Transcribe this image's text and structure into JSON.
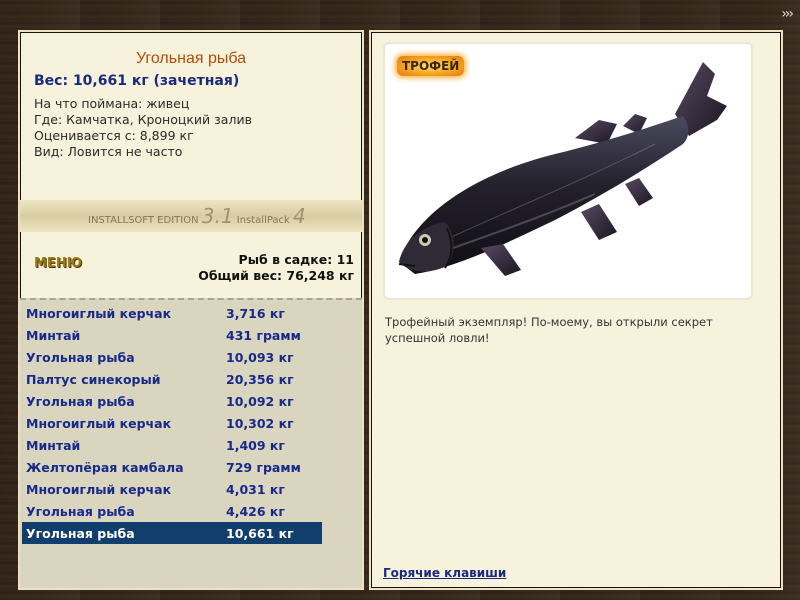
{
  "nav": {
    "next_icon": "triple-chevron-right-icon",
    "next_label": "›››"
  },
  "fish": {
    "title": "Угольная рыба",
    "weight": "Вес: 10,661 кг (зачетная)",
    "bait": "На что поймана: живец",
    "location": "Где: Камчатка, Кроноцкий залив",
    "valued_from": "Оценивается с: 8,899 кг",
    "rarity": "Вид: Ловится не часто"
  },
  "watermark": {
    "line1": "INSTALLSOFT EDITION",
    "version": "3.1",
    "pack": "InstallPack",
    "pack_version": "4"
  },
  "menu": {
    "label": "МЕНЮ"
  },
  "keepnet": {
    "count": "Рыб в садке: 11",
    "total_weight": "Общий вес: 76,248 кг"
  },
  "catches": [
    {
      "name": "Многоиглый керчак",
      "weight": "3,716 кг"
    },
    {
      "name": "Минтай",
      "weight": "431 грамм"
    },
    {
      "name": "Угольная рыба",
      "weight": "10,093 кг"
    },
    {
      "name": "Палтус синекорый",
      "weight": "20,356 кг"
    },
    {
      "name": "Угольная рыба",
      "weight": "10,092 кг"
    },
    {
      "name": "Многоиглый керчак",
      "weight": "10,302 кг"
    },
    {
      "name": "Минтай",
      "weight": "1,409 кг"
    },
    {
      "name": "Желтопёрая камбала",
      "weight": "729 грамм"
    },
    {
      "name": "Многоиглый керчак",
      "weight": "4,031 кг"
    },
    {
      "name": "Угольная рыба",
      "weight": "4,426 кг"
    },
    {
      "name": "Угольная рыба",
      "weight": "10,661 кг"
    }
  ],
  "selected_index": 10,
  "photo": {
    "badge": "ТРОФЕЙ",
    "image": "sablefish-photo"
  },
  "trophy_text": "Трофейный экземпляр! По-моему, вы открыли секрет успешной ловли!",
  "hotkeys": "Горячие клавиши",
  "colors": {
    "accent_title": "#b04e0a",
    "list_text": "#172a8a",
    "selection": "#123e6e",
    "panel_bg": "#f7f2dc"
  }
}
